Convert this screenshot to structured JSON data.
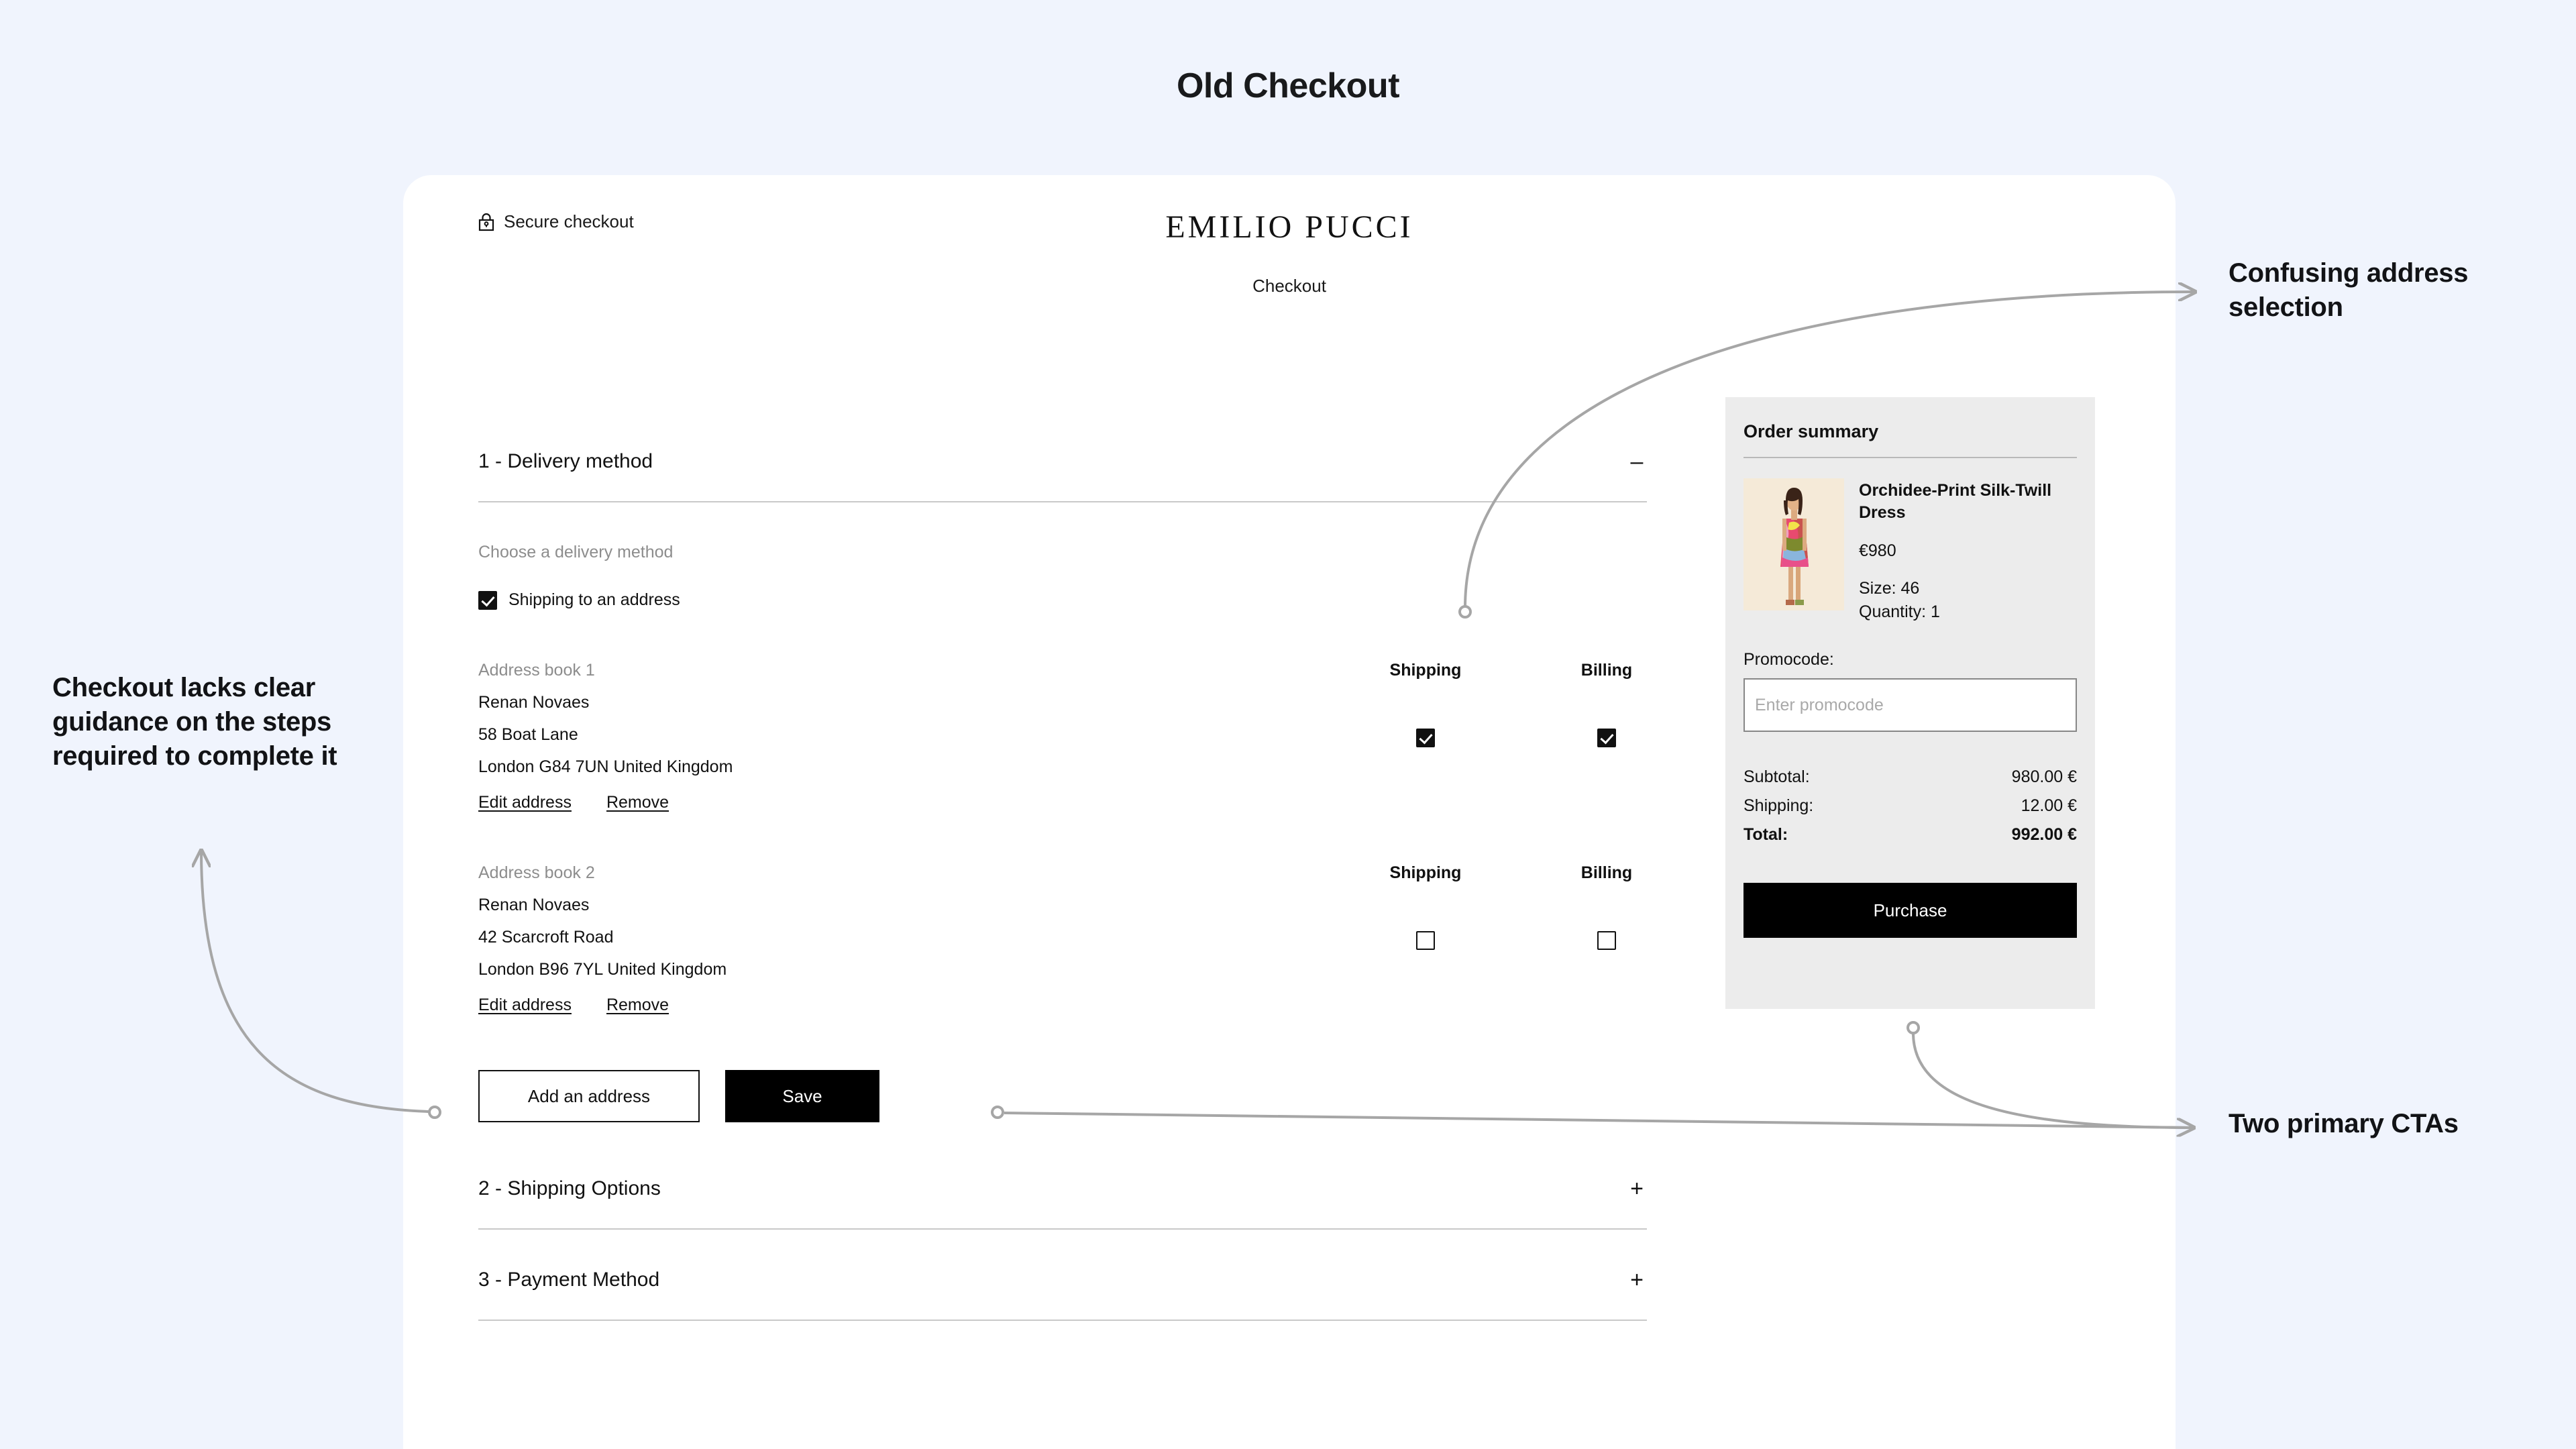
{
  "page": {
    "title": "Old Checkout",
    "background_color": "#f0f4fd"
  },
  "checkout": {
    "secure_label": "Secure checkout",
    "secure_icon": "lock-icon",
    "brand": "EMILIO PUCCI",
    "subtitle": "Checkout",
    "sections": [
      {
        "title": "1 - Delivery method",
        "sign": "–",
        "expanded": true
      },
      {
        "title": "2 - Shipping Options",
        "sign": "+",
        "expanded": false
      },
      {
        "title": "3 - Payment Method",
        "sign": "+",
        "expanded": false
      }
    ],
    "delivery": {
      "choose_label": "Choose a delivery method",
      "shipping_option_label": "Shipping to an address",
      "shipping_option_checked": true,
      "column_headers": {
        "shipping": "Shipping",
        "billing": "Billing"
      },
      "addresses": [
        {
          "book_label": "Address book 1",
          "name": "Renan Novaes",
          "street": "58 Boat Lane",
          "city_line": "London G84 7UN United Kingdom",
          "edit_label": "Edit address",
          "remove_label": "Remove",
          "shipping_checked": true,
          "billing_checked": true
        },
        {
          "book_label": "Address book 2",
          "name": "Renan Novaes",
          "street": "42 Scarcroft Road",
          "city_line": "London  B96 7YL United Kingdom",
          "edit_label": "Edit address",
          "remove_label": "Remove",
          "shipping_checked": false,
          "billing_checked": false
        }
      ],
      "add_address_label": "Add an address",
      "save_label": "Save"
    }
  },
  "order_summary": {
    "title": "Order summary",
    "product": {
      "name": "Orchidee-Print Silk-Twill Dress",
      "price": "€980",
      "size": "Size: 46",
      "quantity": "Quantity: 1",
      "image_alt": "model-wearing-printed-dress"
    },
    "promocode": {
      "label": "Promocode:",
      "placeholder": "Enter promocode",
      "value": ""
    },
    "totals": [
      {
        "label": "Subtotal:",
        "value": "980.00 €",
        "emphasis": false
      },
      {
        "label": "Shipping:",
        "value": "12.00 €",
        "emphasis": false
      },
      {
        "label": "Total:",
        "value": "992.00 €",
        "emphasis": true
      }
    ],
    "purchase_label": "Purchase"
  },
  "annotations": {
    "left": "Checkout lacks clear guidance on the steps required to complete it",
    "address": "Confusing address selection",
    "cta": "Two primary CTAs"
  },
  "colors": {
    "page_bg": "#f0f4fd",
    "card_bg": "#ffffff",
    "summary_bg": "#ececec",
    "primary_dark": "#000000",
    "muted_text": "#8d8d8d",
    "connector": "#a6a6a6"
  }
}
